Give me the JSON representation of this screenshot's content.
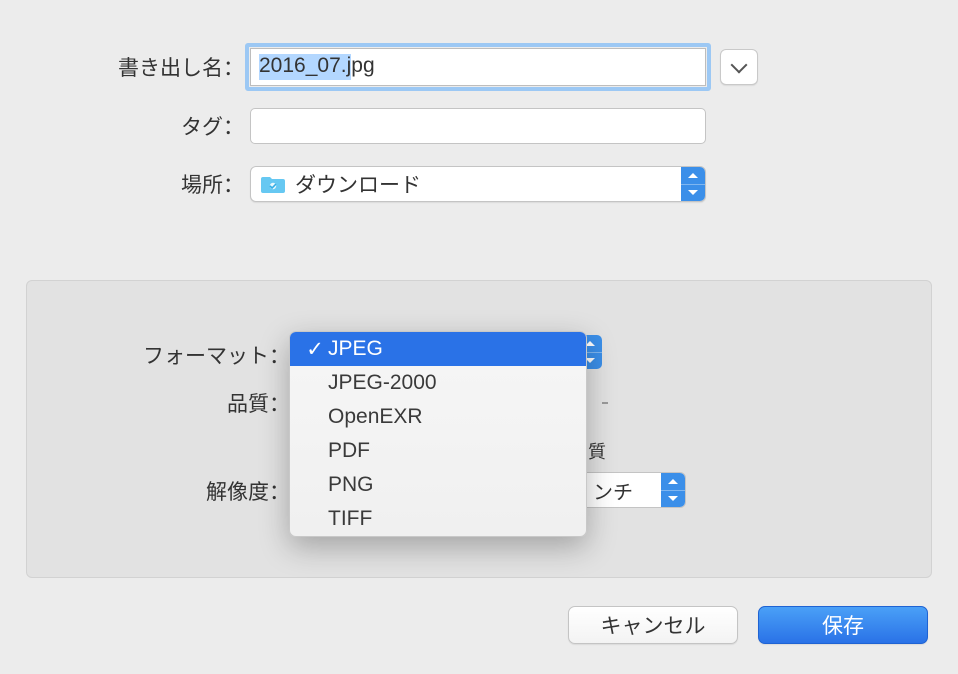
{
  "labels": {
    "filename": "書き出し名：",
    "tags": "タグ：",
    "location": "場所：",
    "format": "フォーマット：",
    "quality": "品質：",
    "resolution": "解像度："
  },
  "filename": {
    "value": "2016_07.jpg",
    "selected": "2016_07",
    "ext": ".jpg"
  },
  "tags": {
    "value": ""
  },
  "location": {
    "value": "ダウンロード",
    "icon": "folder-icon"
  },
  "format_menu": {
    "selected": "JPEG",
    "options": [
      "JPEG",
      "JPEG-2000",
      "OpenEXR",
      "PDF",
      "PNG",
      "TIFF"
    ]
  },
  "quality_peek": "質",
  "resolution_unit_peek": "ンチ",
  "buttons": {
    "cancel": "キャンセル",
    "save": "保存"
  },
  "colors": {
    "accent": "#2a72e7"
  }
}
